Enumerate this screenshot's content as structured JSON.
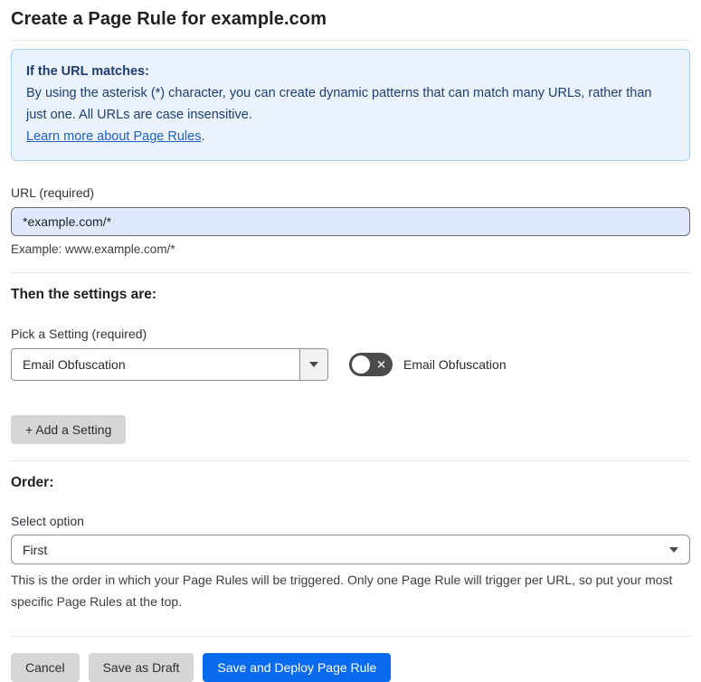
{
  "page": {
    "title": "Create a Page Rule for example.com"
  },
  "info_box": {
    "heading": "If the URL matches:",
    "body": "By using the asterisk (*) character, you can create dynamic patterns that can match many URLs, rather than just one. All URLs are case insensitive.",
    "link": "Learn more about Page Rules",
    "link_suffix": "."
  },
  "url_field": {
    "label": "URL (required)",
    "value": "*example.com/*",
    "helper": "Example: www.example.com/*"
  },
  "settings_section": {
    "heading": "Then the settings are:",
    "picker_label": "Pick a Setting (required)",
    "picker_value": "Email Obfuscation",
    "toggle_label": "Email Obfuscation",
    "toggle_state": "off",
    "toggle_glyph": "✕",
    "add_setting_button": "+ Add a Setting"
  },
  "order_section": {
    "heading": "Order:",
    "select_label": "Select option",
    "select_value": "First",
    "helper": "This is the order in which your Page Rules will be triggered. Only one Page Rule will trigger per URL, so put your most specific Page Rules at the top."
  },
  "footer": {
    "cancel": "Cancel",
    "save_draft": "Save as Draft",
    "save_deploy": "Save and Deploy Page Rule"
  },
  "colors": {
    "accent_blue": "#0b6bef",
    "info_background": "#eaf2fc",
    "info_border": "#a9cdf0",
    "info_text": "#1e3d70",
    "link_blue": "#2261c4",
    "url_input_background": "#dfe9fb",
    "toggle_track_off": "#4b4b4b",
    "button_gray": "#d6d6d6"
  }
}
